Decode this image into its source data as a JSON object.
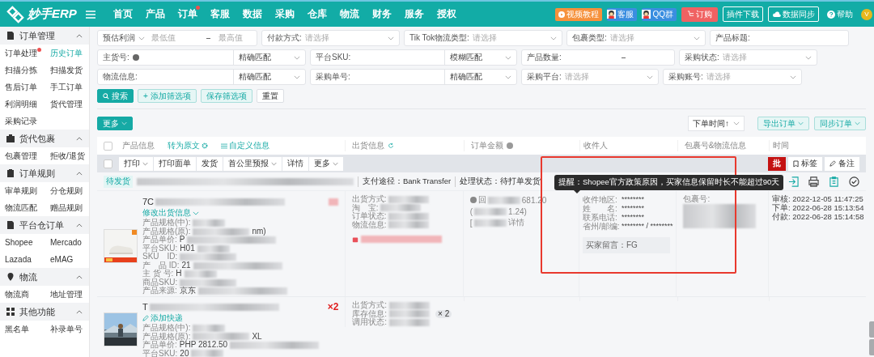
{
  "topbar": {
    "logo": "妙手ERP",
    "nav": [
      {
        "label": "首页",
        "dot": false
      },
      {
        "label": "产品",
        "dot": false
      },
      {
        "label": "订单",
        "dot": true
      },
      {
        "label": "客服",
        "dot": false
      },
      {
        "label": "数据",
        "dot": false
      },
      {
        "label": "采购",
        "dot": false
      },
      {
        "label": "仓库",
        "dot": false
      },
      {
        "label": "物流",
        "dot": false
      },
      {
        "label": "财务",
        "dot": false
      },
      {
        "label": "服务",
        "dot": false
      },
      {
        "label": "授权",
        "dot": false
      }
    ],
    "actions": [
      {
        "kind": "video",
        "label": "视频教程"
      },
      {
        "kind": "qq",
        "label": "客服"
      },
      {
        "kind": "qq",
        "label": "QQ群"
      },
      {
        "kind": "buy",
        "label": "订购"
      },
      {
        "kind": "outline",
        "label": "插件下载"
      },
      {
        "kind": "cloud",
        "label": "数据同步"
      },
      {
        "kind": "help",
        "label": "帮助"
      }
    ],
    "avatar": "V"
  },
  "sidebar": [
    {
      "title": "订单管理",
      "expanded": true,
      "items": [
        {
          "label": "订单处理",
          "dot": true,
          "selected": false
        },
        {
          "label": "历史订单",
          "dot": false,
          "selected": true
        },
        {
          "label": "扫描分拣",
          "dot": false,
          "selected": false
        },
        {
          "label": "扫描发货",
          "dot": false,
          "selected": false
        },
        {
          "label": "售后订单",
          "dot": false,
          "selected": false
        },
        {
          "label": "手工订单",
          "dot": false,
          "selected": false
        },
        {
          "label": "利润明细",
          "dot": false,
          "selected": false
        },
        {
          "label": "货代管理",
          "dot": false,
          "selected": false
        },
        {
          "label": "采购记录",
          "dot": false,
          "selected": false
        }
      ]
    },
    {
      "title": "货代包裹",
      "expanded": true,
      "items": [
        {
          "label": "包裹管理",
          "dot": false,
          "selected": false
        },
        {
          "label": "拒收/退货",
          "dot": false,
          "selected": false
        }
      ]
    },
    {
      "title": "订单规则",
      "expanded": true,
      "items": [
        {
          "label": "审单规则",
          "dot": false,
          "selected": false
        },
        {
          "label": "分仓规则",
          "dot": false,
          "selected": false
        },
        {
          "label": "物流匹配",
          "dot": false,
          "selected": false
        },
        {
          "label": "赠品规则",
          "dot": false,
          "selected": false
        }
      ]
    },
    {
      "title": "平台仓订单",
      "expanded": true,
      "items": [
        {
          "label": "Shopee",
          "dot": false,
          "selected": false
        },
        {
          "label": "Mercado",
          "dot": false,
          "selected": false
        },
        {
          "label": "Lazada",
          "dot": false,
          "selected": false
        },
        {
          "label": "eMAG",
          "dot": false,
          "selected": false
        }
      ]
    },
    {
      "title": "物流",
      "expanded": true,
      "items": [
        {
          "label": "物流商",
          "dot": false,
          "selected": false
        },
        {
          "label": "地址管理",
          "dot": false,
          "selected": false
        }
      ]
    },
    {
      "title": "其他功能",
      "expanded": true,
      "items": [
        {
          "label": "黑名单",
          "dot": false,
          "selected": false
        },
        {
          "label": "补录单号",
          "dot": false,
          "selected": false
        }
      ]
    }
  ],
  "filters": {
    "fields": [
      {
        "kind": "range",
        "select": "预估利润",
        "min": "最低值",
        "max": "最高值"
      },
      {
        "kind": "select",
        "label": "付款方式:",
        "placeholder": "请选择"
      },
      {
        "kind": "select",
        "label": "Tik Tok物流类型:",
        "placeholder": "请选择"
      },
      {
        "kind": "select",
        "label": "包裹类型:",
        "placeholder": "请选择"
      },
      {
        "kind": "text",
        "label": "产品标题:"
      },
      {
        "kind": "match",
        "label": "主货号:",
        "help": true,
        "match": "精确匹配"
      },
      {
        "kind": "match",
        "label": "平台SKU:",
        "help": false,
        "match": "模糊匹配"
      },
      {
        "kind": "num",
        "label": "产品数量:"
      },
      {
        "kind": "select",
        "label": "采购状态:",
        "placeholder": "请选择"
      },
      {
        "kind": "match",
        "label": "物流信息:",
        "help": false,
        "match": "精确匹配"
      },
      {
        "kind": "match",
        "label": "采购单号:",
        "help": false,
        "match": "精确匹配"
      },
      {
        "kind": "select",
        "label": "采购平台:",
        "placeholder": "请选择"
      },
      {
        "kind": "select",
        "label": "采购账号:",
        "placeholder": "请选择"
      }
    ],
    "buttons": [
      {
        "kind": "primary",
        "label": "搜索"
      },
      {
        "kind": "light",
        "label": "+ 添加筛选项"
      },
      {
        "kind": "light",
        "label": "保存筛选项"
      },
      {
        "kind": "plain",
        "label": "重置"
      }
    ]
  },
  "toolbar": {
    "more": "更多",
    "sort": "下单时间↑",
    "export": "导出订单",
    "sync": "同步订单"
  },
  "table": {
    "header_checkbox": {
      "checked": false
    },
    "bar_checkbox": {
      "checked": false
    },
    "columns": [
      {
        "label": "产品信息"
      },
      {
        "label": "出货信息"
      },
      {
        "label": "订单金额"
      },
      {
        "label": "收件人"
      },
      {
        "label": "包裹号&物流信息"
      },
      {
        "label": "时间"
      }
    ],
    "links": [
      "转为原文",
      "自定义信息"
    ],
    "actions": [
      {
        "label": "打印",
        "caret": true
      },
      {
        "label": "打印面单",
        "caret": false
      },
      {
        "label": "发货",
        "caret": false
      },
      {
        "label": "首公里预报",
        "caret": true
      },
      {
        "label": "详情",
        "caret": false
      },
      {
        "label": "更多",
        "caret": true
      }
    ],
    "right_actions": [
      {
        "kind": "batch",
        "label": "批"
      },
      {
        "kind": "tag",
        "label": "标签"
      },
      {
        "kind": "note",
        "label": "备注"
      }
    ]
  },
  "order": {
    "status": "待发货",
    "payment": "支付途径：Bank Transfer",
    "process": "处理状态：待打单发货",
    "tooltip": "提醒：Shopee官方政策原因，买家信息保留时长不能超过90天",
    "products": [
      {
        "title": "7C",
        "link": "修改出货信息",
        "fields": [
          {
            "label": "产品规格(中):"
          },
          {
            "label": "产品规格(原):",
            "tail": "nm)"
          },
          {
            "label": "产品单价:",
            "value": "P"
          },
          {
            "label": "平台SKU:",
            "value": "H01"
          },
          {
            "label": "SKU　ID:"
          },
          {
            "label": "产　品 ID:",
            "value": "21"
          },
          {
            "label": "主 货 号:",
            "value": "H"
          },
          {
            "label": "商品SKU:"
          },
          {
            "label": "产品来源:",
            "value": "京东"
          }
        ],
        "ship": [
          {
            "label": "出货方式:"
          },
          {
            "label": "淘　宝:"
          },
          {
            "label": "订单状态:"
          },
          {
            "label": "物流信息:"
          }
        ],
        "sync_warning": true,
        "amount": [
          {
            "prefix": "回",
            "tail": "681.20",
            "help": true
          },
          {
            "prefix": "(",
            "tail": "1.24)",
            "help": false
          },
          {
            "prefix": "[",
            "tail": "详情",
            "help": false
          }
        ],
        "receiver": [
          {
            "label": "收件地区:",
            "value": "********"
          },
          {
            "label": "姓　　名:",
            "value": "********"
          },
          {
            "label": "联系电话:",
            "value": "********"
          },
          {
            "label": "省州/邮编:",
            "value": "******** / ********"
          }
        ],
        "message": "买家留言：FG",
        "package": "包裹号:",
        "times": [
          "审核:  2022-12-05 11:47:25",
          "下单:  2022-06-28 15:13:54",
          "付款:  2022-06-28 15:14:58"
        ]
      },
      {
        "title": "T",
        "qty": "×2",
        "link": "添加快递",
        "fields": [
          {
            "label": "产品规格(中):"
          },
          {
            "label": "产品规格(原):",
            "tail": "XL"
          },
          {
            "label": "产品单价:",
            "value": "PHP 2812.50"
          },
          {
            "label": "平台SKU:",
            "value": "20"
          }
        ],
        "ship": [
          {
            "label": "出货方式:"
          },
          {
            "label": "库存信息:",
            "extra": "× 2"
          },
          {
            "label": "调用状态:"
          }
        ],
        "sync_warning": false
      }
    ]
  }
}
